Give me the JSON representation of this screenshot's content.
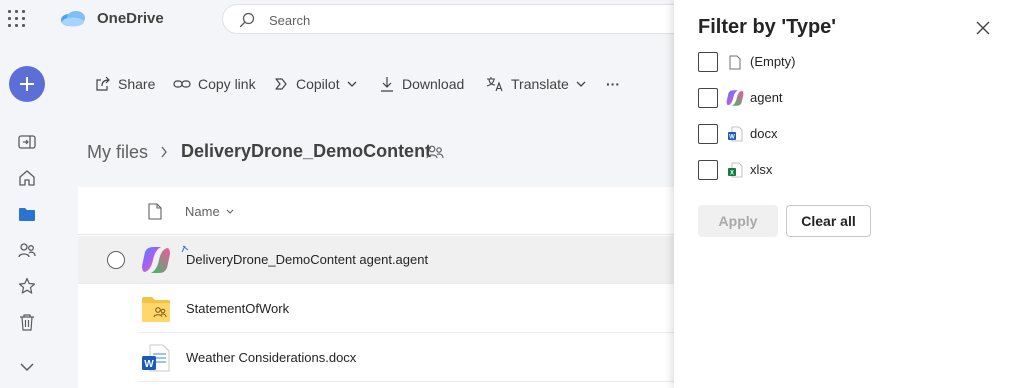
{
  "app": {
    "title": "OneDrive"
  },
  "search": {
    "placeholder": "Search"
  },
  "toolbar": {
    "share": "Share",
    "copy_link": "Copy link",
    "copilot": "Copilot",
    "download": "Download",
    "translate": "Translate",
    "more": "···"
  },
  "breadcrumb": {
    "root": "My files",
    "separator": "›",
    "current": "DeliveryDrone_DemoContent"
  },
  "list": {
    "columns": {
      "name": "Name"
    },
    "rows": [
      {
        "name": "DeliveryDrone_DemoContent agent.agent",
        "type": "agent",
        "selected": true
      },
      {
        "name": "StatementOfWork",
        "type": "shared-folder",
        "selected": false
      },
      {
        "name": "Weather Considerations.docx",
        "type": "docx",
        "selected": false
      }
    ]
  },
  "filter_panel": {
    "title": "Filter by 'Type'",
    "options": [
      {
        "label": "(Empty)",
        "icon": "blank-file-icon",
        "checked": false
      },
      {
        "label": "agent",
        "icon": "copilot-agent-icon",
        "checked": false
      },
      {
        "label": "docx",
        "icon": "word-file-icon",
        "checked": false
      },
      {
        "label": "xlsx",
        "icon": "excel-file-icon",
        "checked": false
      }
    ],
    "apply_label": "Apply",
    "clear_label": "Clear all"
  },
  "colors": {
    "accent": "#5c6fd6",
    "panel_bg": "#ffffff",
    "page_bg": "#f3f5f8",
    "word_blue": "#185abd",
    "excel_green": "#107c41",
    "folder_yellow": "#f5c342"
  }
}
